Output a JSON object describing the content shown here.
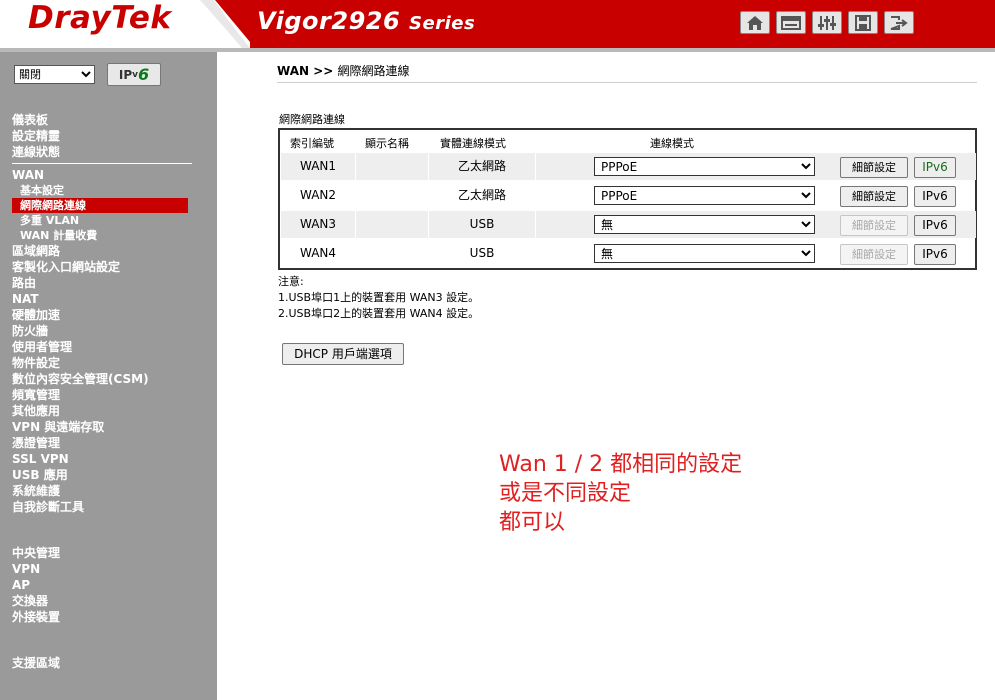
{
  "header": {
    "logo": "DrayTek",
    "model": "Vigor2926",
    "series": "Series",
    "icons": [
      "home-icon",
      "quick-start-icon",
      "settings-sliders-icon",
      "save-icon",
      "logout-icon"
    ]
  },
  "sidebar": {
    "language_select": "關閉",
    "ipv6_label_ip": "IP",
    "ipv6_label_v": "v",
    "ipv6_label_6": "6",
    "menu": [
      {
        "label": "儀表板",
        "level": "top"
      },
      {
        "label": "設定精靈",
        "level": "top"
      },
      {
        "label": "連線狀態",
        "level": "top"
      },
      {
        "label": "",
        "level": "sep"
      },
      {
        "label": "WAN",
        "level": "top"
      },
      {
        "label": "基本設定",
        "level": "sub"
      },
      {
        "label": "網際網路連線",
        "level": "sub",
        "active": true
      },
      {
        "label": "多重 VLAN",
        "level": "sub"
      },
      {
        "label": "WAN 計量收費",
        "level": "sub"
      },
      {
        "label": "區域網路",
        "level": "top"
      },
      {
        "label": "客製化入口網站設定",
        "level": "top"
      },
      {
        "label": "路由",
        "level": "top"
      },
      {
        "label": "NAT",
        "level": "top"
      },
      {
        "label": "硬體加速",
        "level": "top"
      },
      {
        "label": "防火牆",
        "level": "top"
      },
      {
        "label": "使用者管理",
        "level": "top"
      },
      {
        "label": "物件設定",
        "level": "top"
      },
      {
        "label": "數位內容安全管理(CSM)",
        "level": "top"
      },
      {
        "label": "頻寬管理",
        "level": "top"
      },
      {
        "label": "其他應用",
        "level": "top"
      },
      {
        "label": "VPN 與遠端存取",
        "level": "top"
      },
      {
        "label": "憑證管理",
        "level": "top"
      },
      {
        "label": "SSL VPN",
        "level": "top"
      },
      {
        "label": "USB 應用",
        "level": "top"
      },
      {
        "label": "系統維護",
        "level": "top"
      },
      {
        "label": "自我診斷工具",
        "level": "top"
      },
      {
        "label": "",
        "level": "gap"
      },
      {
        "label": "中央管理",
        "level": "top"
      },
      {
        "label": "VPN",
        "level": "top"
      },
      {
        "label": "AP",
        "level": "top"
      },
      {
        "label": "交換器",
        "level": "top"
      },
      {
        "label": "外接裝置",
        "level": "top"
      },
      {
        "label": "",
        "level": "gap"
      },
      {
        "label": "支援區域",
        "level": "top"
      }
    ]
  },
  "main": {
    "breadcrumb_parent": "WAN >> ",
    "breadcrumb_current": "網際網路連線",
    "section_title": "網際網路連線",
    "table": {
      "headers": {
        "index": "索引編號",
        "name": "顯示名稱",
        "physical": "實體連線模式",
        "mode": "連線模式"
      },
      "rows": [
        {
          "index": "WAN1",
          "name": "",
          "physical": "乙太網路",
          "mode": "PPPoE",
          "detail": "細節設定",
          "detail_enabled": true,
          "ipv6": "IPv6",
          "ipv6_green": true
        },
        {
          "index": "WAN2",
          "name": "",
          "physical": "乙太網路",
          "mode": "PPPoE",
          "detail": "細節設定",
          "detail_enabled": true,
          "ipv6": "IPv6",
          "ipv6_green": false
        },
        {
          "index": "WAN3",
          "name": "",
          "physical": "USB",
          "mode": "無",
          "detail": "細節設定",
          "detail_enabled": false,
          "ipv6": "IPv6",
          "ipv6_green": false
        },
        {
          "index": "WAN4",
          "name": "",
          "physical": "USB",
          "mode": "無",
          "detail": "細節設定",
          "detail_enabled": false,
          "ipv6": "IPv6",
          "ipv6_green": false
        }
      ]
    },
    "notes": {
      "title": "注意:",
      "line1": "1.USB埠口1上的裝置套用 WAN3 設定。",
      "line2": "2.USB埠口2上的裝置套用 WAN4 設定。"
    },
    "dhcp_button": "DHCP 用戶端選項",
    "annotation": {
      "line1": "Wan 1 / 2 都相同的設定",
      "line2": "或是不同設定",
      "line3": "都可以"
    }
  },
  "colors": {
    "brand_red": "#c80000",
    "sidebar_gray": "#9a9a9a",
    "annotation_red": "#e02020"
  }
}
